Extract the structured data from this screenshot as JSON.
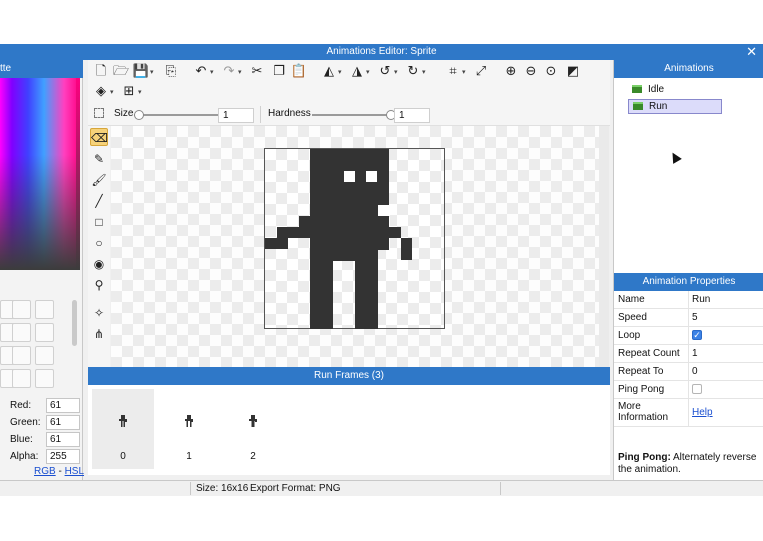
{
  "window": {
    "title": "Animations Editor: Sprite",
    "close_glyph": "✕"
  },
  "palette": {
    "title_fragment": "tte",
    "colors": {
      "accent": "#2f78c8"
    },
    "color_fields": [
      {
        "label": "Red:",
        "value": "61"
      },
      {
        "label": "Green:",
        "value": "61"
      },
      {
        "label": "Blue:",
        "value": "61"
      },
      {
        "label": "Alpha:",
        "value": "255"
      }
    ],
    "mode_links": {
      "rgb": "RGB",
      "separator": " - ",
      "hsl": "HSL"
    }
  },
  "toolbar": {
    "icons": [
      "new-file-icon",
      "open-folder-icon",
      "save-icon",
      "export-icon",
      "undo-icon",
      "redo-icon",
      "cut-icon",
      "copy-icon",
      "paste-icon",
      "flip-horizontal-icon",
      "flip-vertical-icon",
      "rotate-left-icon",
      "rotate-right-icon",
      "crop-icon",
      "resize-icon",
      "zoom-in-icon",
      "zoom-out-icon",
      "zoom-fit-icon",
      "zoom-actual-icon",
      "layers-icon",
      "grid-icon"
    ]
  },
  "options": {
    "size_label": "Size",
    "size_value": "1",
    "hardness_label": "Hardness",
    "hardness_value": "1"
  },
  "tools": [
    "eraser-tool-icon",
    "pencil-tool-icon",
    "brush-tool-icon",
    "line-tool-icon",
    "rectangle-tool-icon",
    "ellipse-tool-icon",
    "fill-tool-icon",
    "eyedropper-tool-icon",
    "move-tool-icon",
    "node-tool-icon"
  ],
  "frames": {
    "header": "Run Frames (3)",
    "items": [
      {
        "index": "0"
      },
      {
        "index": "1"
      },
      {
        "index": "2"
      }
    ]
  },
  "animations": {
    "header": "Animations",
    "items": [
      {
        "label": "Idle"
      },
      {
        "label": "Run"
      }
    ],
    "selected": "Run"
  },
  "properties": {
    "header": "Animation Properties",
    "rows": {
      "name": {
        "label": "Name",
        "value": "Run"
      },
      "speed": {
        "label": "Speed",
        "value": "5"
      },
      "loop": {
        "label": "Loop",
        "checked": true
      },
      "repeat_count": {
        "label": "Repeat Count",
        "value": "1"
      },
      "repeat_to": {
        "label": "Repeat To",
        "value": "0"
      },
      "ping_pong": {
        "label": "Ping Pong",
        "checked": false
      },
      "more_info": {
        "label_line1": "More",
        "label_line2": "Information",
        "link": "Help"
      }
    },
    "description": {
      "bold": "Ping Pong:",
      "text": " Alternately reverse the animation."
    }
  },
  "status": {
    "size": "Size: 16x16",
    "export_format": "Export Format: PNG"
  }
}
